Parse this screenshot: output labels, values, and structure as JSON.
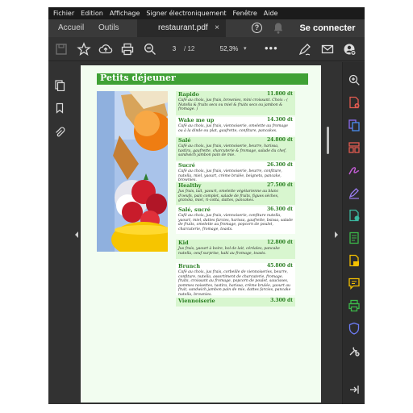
{
  "menubar": {
    "items": [
      "Fichier",
      "Edition",
      "Affichage",
      "Signer électroniquement",
      "Fenêtre",
      "Aide"
    ]
  },
  "tabs": {
    "home": "Accueil",
    "tools": "Outils",
    "file": "restaurant.pdf",
    "close": "×",
    "signin": "Se connecter"
  },
  "toolbar": {
    "current_page": "3",
    "total_pages": "/ 12",
    "zoom": "52,3%",
    "zoom_caret": "▾",
    "more": "•••"
  },
  "colors": {
    "banner": "#3fa135",
    "item_title": "#2a7f22",
    "page_bg": "#f2fdf0",
    "shade": "#d8f6cf"
  },
  "document": {
    "section_title": "Petits déjeuner",
    "items": [
      {
        "name": "Rapido",
        "price": "11.800 dt",
        "desc": "Café au choix, jus frais, brownies, mini croissant. Choix : ( Nutella & fruits secs ou miel & fruits secs ou jambon & fromage. )"
      },
      {
        "name": "Wake me up",
        "price": "14.300 dt",
        "desc": "Café au choix, jus frais, viennoiserie, omelette au fromage ou à la dinde ou plat, gaufrette, confiture, pancakes."
      },
      {
        "name": "Salé",
        "price": "24.800 dt",
        "desc": "Café au choix, jus frais, viennoiserie, beurre, harissa, tastira, gaufrette, charcuterie & fromage, salade du chef, sandwich jambon pain de mie."
      },
      {
        "name": "Sucré",
        "price": "26.300 dt",
        "desc": "Café au choix, jus frais, viennoiserie, beurre, confiture, nutella, miel, yaourt, crème brulée, beignets, pancake, brownies."
      },
      {
        "name": "Healthy",
        "price": "27.500 dt",
        "desc": "Jus frais, lait, yaourt, omelette végétarienne au blanc d'oeufs, pain complet, salade de fruits, figues sèches, granola, miel, ri-cotta, dattes, pancakes."
      },
      {
        "name": "Salé, sucré",
        "price": "36.300 dt",
        "desc": "Café au choix, jus frais, viennoiserie, confiture nutella, yaourt, miel, dattes farcies, harissa, gaufrette, bsissa, salade de fruits, omelette au fromage, popcorn de poulet, charcuterie, fromage, toasts."
      },
      {
        "name": "Kid",
        "price": "12.800 dt",
        "desc": "Jus frais, yaourt à boire, bol de lait, céréales, pancake nutella, oeuf surprise, kaki au fromage, toasts."
      },
      {
        "name": "Brunch",
        "price": "45.800 dt",
        "desc": "Café au choix, jus frais, corbeille de viennoiseries, beurre, confiture, nutella, assortiment de charcuterie, fromage, fruits, croissant au fromage, popcorn de poulet, saucisses, pommes noisettes, tastira, harissa, crème brulée, yaourt au fruit, sandwich jambon pain de mie, dattes farcies, pancake nutella, brownies."
      },
      {
        "name": "Viennoiserie",
        "price": "3.300 dt",
        "desc": ""
      }
    ]
  },
  "icons": {
    "toolbar": [
      "save-icon",
      "bookmark-star-icon",
      "cloud-upload-icon",
      "print-icon",
      "zoom-out-icon",
      "page-nav-down-icon",
      "sign-pen-icon",
      "mail-icon",
      "account-add-icon"
    ],
    "left": [
      "page-thumbnails-icon",
      "bookmark-icon",
      "attachment-icon"
    ],
    "right": [
      "zoom-in-icon",
      "create-pdf-icon",
      "combine-files-icon",
      "organize-pages-icon",
      "sign-fill-icon",
      "edit-pen-icon",
      "export-pdf-icon",
      "scan-ocr-icon",
      "comment-file-icon",
      "comment-icon",
      "print-production-icon",
      "protect-icon",
      "tools-more-icon",
      "collapse-panel-icon"
    ]
  }
}
